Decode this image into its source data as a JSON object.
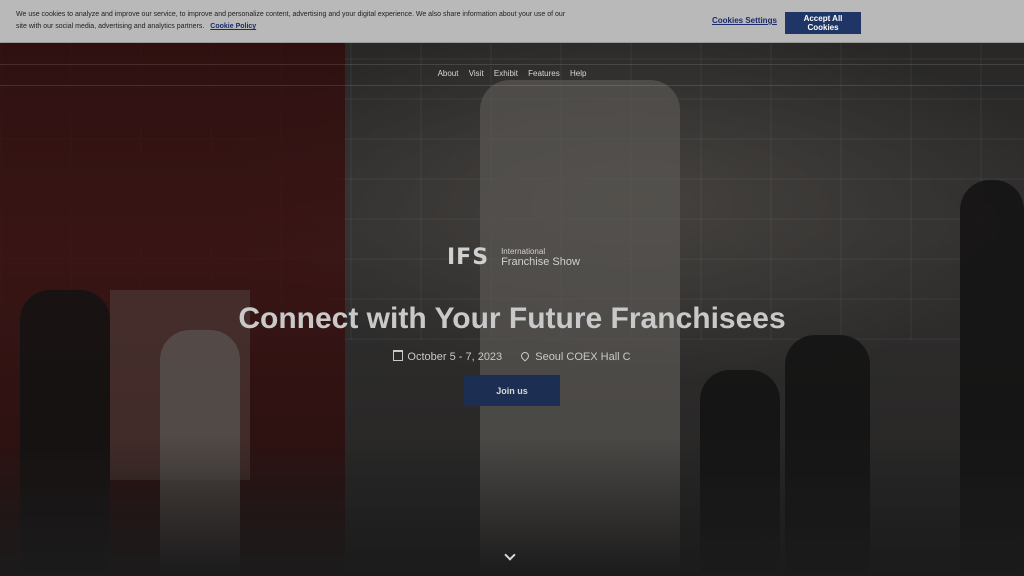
{
  "cookie_banner": {
    "text": "We use cookies to analyze and improve our service, to improve and personalize content, advertising and your digital experience. We also share information about your use of our site with our social media, advertising and analytics partners.",
    "policy_link": "Cookie Policy",
    "settings_label": "Cookies Settings",
    "accept_label": "Accept All Cookies"
  },
  "nav": {
    "items": [
      "About",
      "Visit",
      "Exhibit",
      "Features",
      "Help"
    ]
  },
  "logo": {
    "mark": "IFS",
    "line1": "International",
    "line2": "Franchise Show"
  },
  "hero": {
    "headline": "Connect with Your Future Franchisees",
    "dates": "October 5 - 7, 2023",
    "location": "Seoul COEX Hall C",
    "cta": "Join us"
  },
  "icons": {
    "calendar": "calendar-icon",
    "location": "map-pin-icon",
    "scroll": "chevron-down-icon"
  }
}
